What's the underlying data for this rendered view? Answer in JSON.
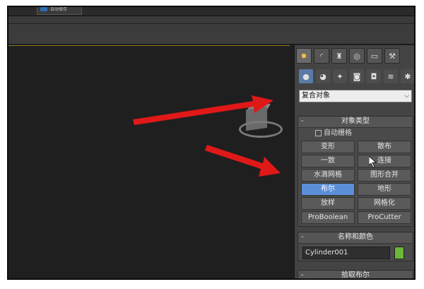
{
  "titlebar": {
    "chip_text": "自动保存"
  },
  "colors": {
    "accent": "#5d8fd8",
    "swatch": "#6cb63a",
    "arrow": "#e01818"
  },
  "command_panel": {
    "tabs": [
      {
        "icon": "create-icon"
      },
      {
        "icon": "modify-icon"
      },
      {
        "icon": "hierarchy-icon"
      },
      {
        "icon": "motion-icon"
      },
      {
        "icon": "display-icon"
      },
      {
        "icon": "utilities-icon"
      }
    ],
    "category_icons": [
      {
        "icon": "geometry-icon"
      },
      {
        "icon": "shapes-icon"
      },
      {
        "icon": "lights-icon"
      },
      {
        "icon": "cameras-icon"
      },
      {
        "icon": "helpers-icon"
      },
      {
        "icon": "spacewarps-icon"
      },
      {
        "icon": "systems-icon"
      }
    ],
    "category_dropdown": "复合对象",
    "object_type": {
      "title": "对象类型",
      "auto_grid": "自动栅格",
      "buttons": [
        "变形",
        "散布",
        "一致",
        "连接",
        "水滴网格",
        "图形合并",
        "布尔",
        "地形",
        "放样",
        "网格化",
        "ProBoolean",
        "ProCutter"
      ],
      "active_button": "布尔"
    },
    "name_color": {
      "title": "名称和颜色",
      "name_value": "Cylinder001"
    },
    "pick_boolean": {
      "title": "拾取布尔"
    }
  }
}
